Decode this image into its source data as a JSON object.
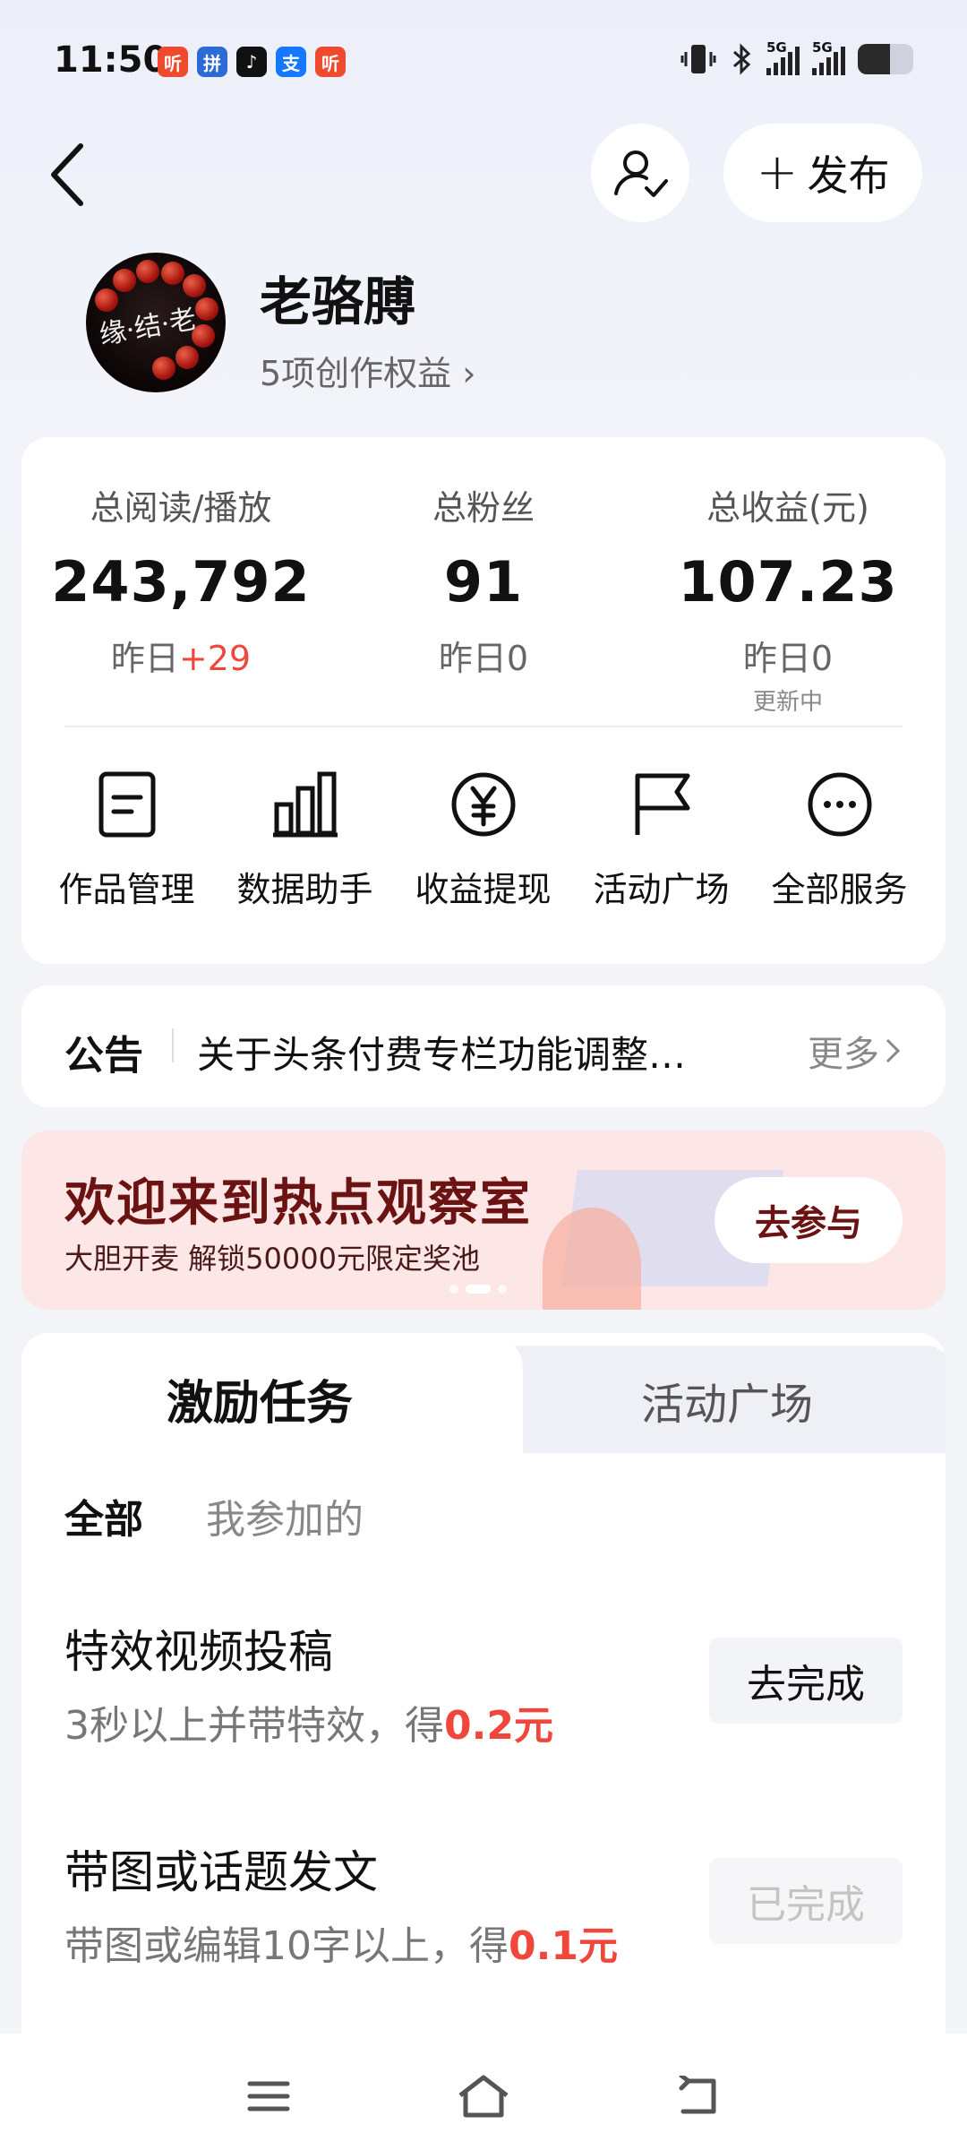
{
  "status_bar": {
    "time": "11:50",
    "apps": [
      {
        "glyph": "听",
        "color": "#f04a2e"
      },
      {
        "glyph": "拼",
        "color": "#2c6bd6"
      },
      {
        "glyph": "♪",
        "color": "#111111"
      },
      {
        "glyph": "支",
        "color": "#1677ff"
      },
      {
        "glyph": "听",
        "color": "#f04a2e"
      }
    ],
    "network_1": "5G",
    "network_2": "5G"
  },
  "header": {
    "publish_label": "发布",
    "publish_plus": "+"
  },
  "profile": {
    "username": "老骆膊",
    "rights_label": "5项创作权益 ›",
    "avatar_text": "缘·结·老"
  },
  "stats": [
    {
      "label": "总阅读/播放",
      "value": "243,792",
      "sub_prefix": "昨日",
      "sub_delta": "+29",
      "note": ""
    },
    {
      "label": "总粉丝",
      "value": "91",
      "sub_prefix": "昨日0",
      "sub_delta": "",
      "note": ""
    },
    {
      "label": "总收益(元)",
      "value": "107.23",
      "sub_prefix": "昨日0",
      "sub_delta": "",
      "note": "更新中"
    }
  ],
  "tools": [
    {
      "label": "作品管理",
      "icon": "document-icon"
    },
    {
      "label": "数据助手",
      "icon": "bar-chart-icon"
    },
    {
      "label": "收益提现",
      "icon": "yuan-icon"
    },
    {
      "label": "活动广场",
      "icon": "flag-icon"
    },
    {
      "label": "全部服务",
      "icon": "more-icon"
    }
  ],
  "notice": {
    "tag": "公告",
    "text": "关于头条付费专栏功能调整…",
    "more": "更多"
  },
  "banner": {
    "title": "欢迎来到热点观察室",
    "subtitle": "大胆开麦 解锁50000元限定奖池",
    "button": "去参与"
  },
  "tasks_section": {
    "tabs": [
      "激励任务",
      "活动广场"
    ],
    "filters": [
      "全部",
      "我参加的"
    ],
    "items": [
      {
        "title": "特效视频投稿",
        "desc_prefix": "3秒以上并带特效，得",
        "reward": "0.2元",
        "button": "去完成",
        "done": false
      },
      {
        "title": "带图或话题发文",
        "desc_prefix": "带图或编辑10字以上，得",
        "reward": "0.1元",
        "button": "已完成",
        "done": true
      }
    ]
  },
  "colors": {
    "accent_red": "#f0463c",
    "banner_bg": "#fde6e6",
    "banner_text": "#6b1212"
  }
}
